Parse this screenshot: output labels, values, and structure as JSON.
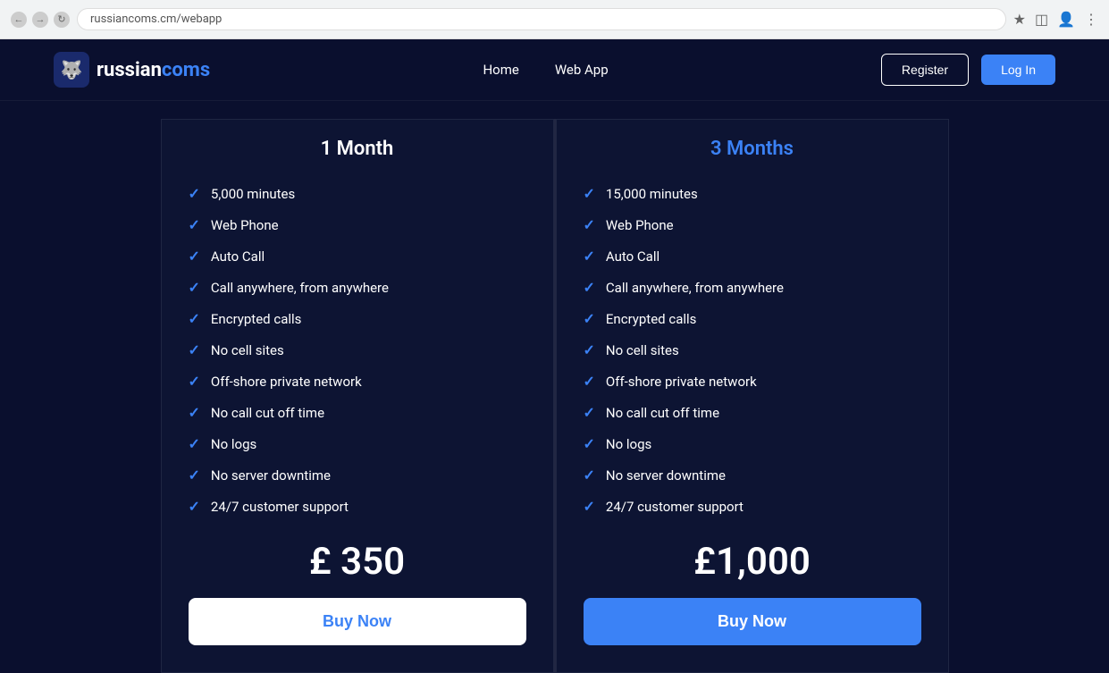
{
  "browser": {
    "url": "russiancoms.cm/webapp",
    "back_btn": "←",
    "forward_btn": "→",
    "refresh_btn": "↻"
  },
  "navbar": {
    "logo_russian": "russian",
    "logo_coms": "coms",
    "nav_home": "Home",
    "nav_webapp": "Web App",
    "btn_register": "Register",
    "btn_login": "Log In"
  },
  "plans": [
    {
      "id": "1month",
      "title": "1 Month",
      "title_style": "white",
      "features": [
        "5,000 minutes",
        "Web Phone",
        "Auto Call",
        "Call anywhere, from anywhere",
        "Encrypted calls",
        "No cell sites",
        "Off-shore private network",
        "No call cut off time",
        "No logs",
        "No server downtime",
        "24/7 customer support"
      ],
      "price": "£ 350",
      "buy_label": "Buy Now",
      "buy_style": "white"
    },
    {
      "id": "3months",
      "title": "3 Months",
      "title_style": "blue",
      "features": [
        "15,000 minutes",
        "Web Phone",
        "Auto Call",
        "Call anywhere, from anywhere",
        "Encrypted calls",
        "No cell sites",
        "Off-shore private network",
        "No call cut off time",
        "No logs",
        "No server downtime",
        "24/7 customer support"
      ],
      "price": "£1,000",
      "buy_label": "Buy Now",
      "buy_style": "blue"
    }
  ]
}
